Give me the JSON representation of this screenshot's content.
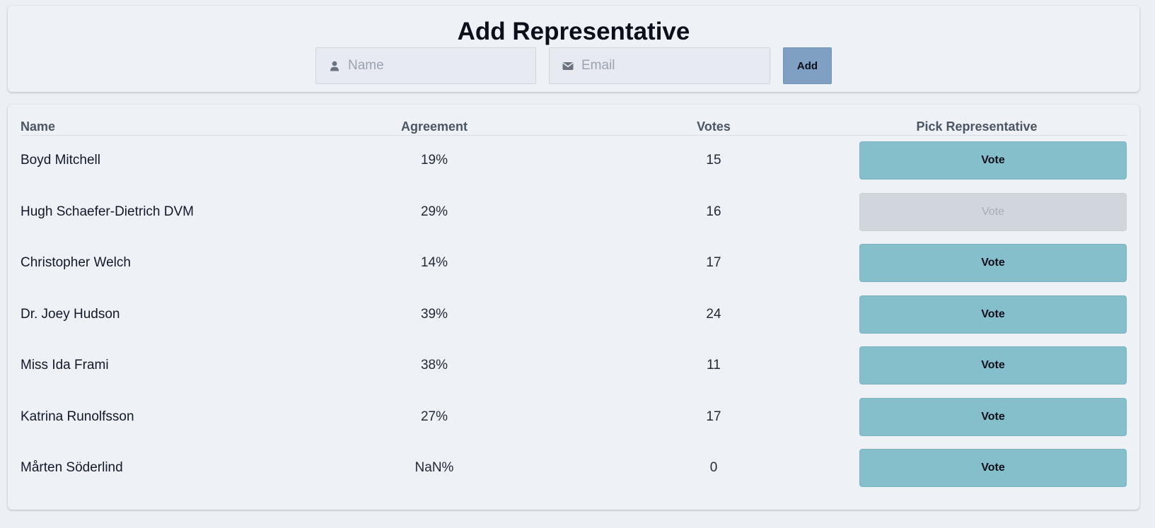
{
  "add_form": {
    "title": "Add Representative",
    "name_field": {
      "placeholder": "Name",
      "value": "",
      "icon": "user-icon"
    },
    "email_field": {
      "placeholder": "Email",
      "value": "",
      "icon": "envelope-icon"
    },
    "add_label": "Add"
  },
  "table": {
    "headers": {
      "name": "Name",
      "agreement": "Agreement",
      "votes": "Votes",
      "pick": "Pick Representative"
    },
    "rows": [
      {
        "name": "Boyd Mitchell",
        "agreement": "19%",
        "votes": "15",
        "vote_label": "Vote",
        "vote_disabled": false
      },
      {
        "name": "Hugh Schaefer-Dietrich DVM",
        "agreement": "29%",
        "votes": "16",
        "vote_label": "Vote",
        "vote_disabled": true
      },
      {
        "name": "Christopher Welch",
        "agreement": "14%",
        "votes": "17",
        "vote_label": "Vote",
        "vote_disabled": false
      },
      {
        "name": "Dr. Joey Hudson",
        "agreement": "39%",
        "votes": "24",
        "vote_label": "Vote",
        "vote_disabled": false
      },
      {
        "name": "Miss Ida Frami",
        "agreement": "38%",
        "votes": "11",
        "vote_label": "Vote",
        "vote_disabled": false
      },
      {
        "name": "Katrina Runolfsson",
        "agreement": "27%",
        "votes": "17",
        "vote_label": "Vote",
        "vote_disabled": false
      },
      {
        "name": "Mårten Söderlind",
        "agreement": "NaN%",
        "votes": "0",
        "vote_label": "Vote",
        "vote_disabled": false
      }
    ]
  },
  "colors": {
    "page_background": "#eceff4",
    "card_background": "#eef2f7",
    "add_button": "#7fa0c2",
    "vote_button": "#86bfcc",
    "vote_button_disabled": "#d1d5dc"
  }
}
